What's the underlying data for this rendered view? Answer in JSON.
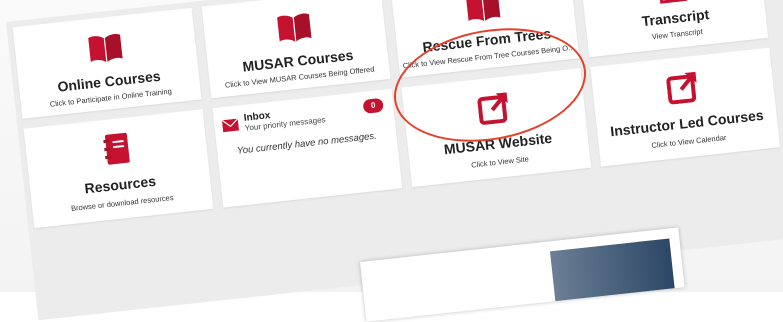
{
  "tiles": {
    "online_courses": {
      "title": "Online Courses",
      "subtitle": "Click to Participate in Online Training",
      "icon": "book-icon"
    },
    "musar_courses": {
      "title": "MUSAR Courses",
      "subtitle": "Click to View MUSAR Courses Being Offered",
      "icon": "book-icon"
    },
    "rescue_from_trees": {
      "title": "Rescue From Trees",
      "subtitle": "Click to View Rescue From Tree Courses Being O...",
      "icon": "book-icon"
    },
    "transcript": {
      "title": "Transcript",
      "subtitle": "View Transcript",
      "icon": "certificate-icon"
    },
    "resources": {
      "title": "Resources",
      "subtitle": "Browse or download resources",
      "icon": "notebook-icon"
    },
    "inbox": {
      "title": "Inbox",
      "subtitle": "Your priority messages",
      "count": "0",
      "empty_message": "You currently have no messages.",
      "icon": "envelope-icon"
    },
    "musar_website": {
      "title": "MUSAR Website",
      "subtitle": "Click to View Site",
      "icon": "external-link-icon"
    },
    "instructor_led": {
      "title": "Instructor Led Courses",
      "subtitle": "Click to View Calendar",
      "icon": "external-link-icon"
    }
  },
  "colors": {
    "accent": "#c41230",
    "highlight_ring": "#e4402a",
    "background": "#ececec",
    "tile": "#ffffff"
  }
}
